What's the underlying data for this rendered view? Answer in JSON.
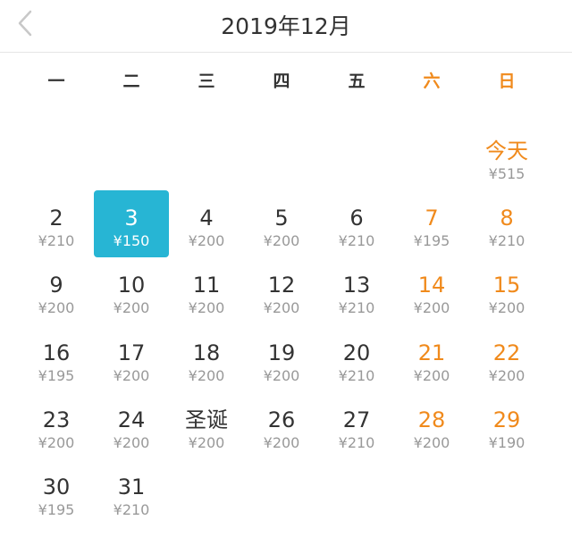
{
  "header": {
    "title": "2019年12月",
    "back_icon": "chevron-left-icon"
  },
  "colors": {
    "weekend": "#f08a1c",
    "selected_bg": "#27b5d4",
    "price": "#999999",
    "text": "#333333"
  },
  "weekdays": [
    "一",
    "二",
    "三",
    "四",
    "五",
    "六",
    "日"
  ],
  "leading_empty": 6,
  "selected_date": 3,
  "days": [
    {
      "label": "今天",
      "price": "¥515",
      "date": 1,
      "today": true
    },
    {
      "label": "2",
      "price": "¥210",
      "date": 2
    },
    {
      "label": "3",
      "price": "¥150",
      "date": 3
    },
    {
      "label": "4",
      "price": "¥200",
      "date": 4
    },
    {
      "label": "5",
      "price": "¥200",
      "date": 5
    },
    {
      "label": "6",
      "price": "¥210",
      "date": 6
    },
    {
      "label": "7",
      "price": "¥195",
      "date": 7
    },
    {
      "label": "8",
      "price": "¥210",
      "date": 8
    },
    {
      "label": "9",
      "price": "¥200",
      "date": 9
    },
    {
      "label": "10",
      "price": "¥200",
      "date": 10
    },
    {
      "label": "11",
      "price": "¥200",
      "date": 11
    },
    {
      "label": "12",
      "price": "¥200",
      "date": 12
    },
    {
      "label": "13",
      "price": "¥210",
      "date": 13
    },
    {
      "label": "14",
      "price": "¥200",
      "date": 14
    },
    {
      "label": "15",
      "price": "¥200",
      "date": 15
    },
    {
      "label": "16",
      "price": "¥195",
      "date": 16
    },
    {
      "label": "17",
      "price": "¥200",
      "date": 17
    },
    {
      "label": "18",
      "price": "¥200",
      "date": 18
    },
    {
      "label": "19",
      "price": "¥200",
      "date": 19
    },
    {
      "label": "20",
      "price": "¥210",
      "date": 20
    },
    {
      "label": "21",
      "price": "¥200",
      "date": 21
    },
    {
      "label": "22",
      "price": "¥200",
      "date": 22
    },
    {
      "label": "23",
      "price": "¥200",
      "date": 23
    },
    {
      "label": "24",
      "price": "¥200",
      "date": 24
    },
    {
      "label": "圣诞",
      "price": "¥200",
      "date": 25
    },
    {
      "label": "26",
      "price": "¥200",
      "date": 26
    },
    {
      "label": "27",
      "price": "¥210",
      "date": 27
    },
    {
      "label": "28",
      "price": "¥200",
      "date": 28
    },
    {
      "label": "29",
      "price": "¥190",
      "date": 29
    },
    {
      "label": "30",
      "price": "¥195",
      "date": 30
    },
    {
      "label": "31",
      "price": "¥210",
      "date": 31
    }
  ]
}
